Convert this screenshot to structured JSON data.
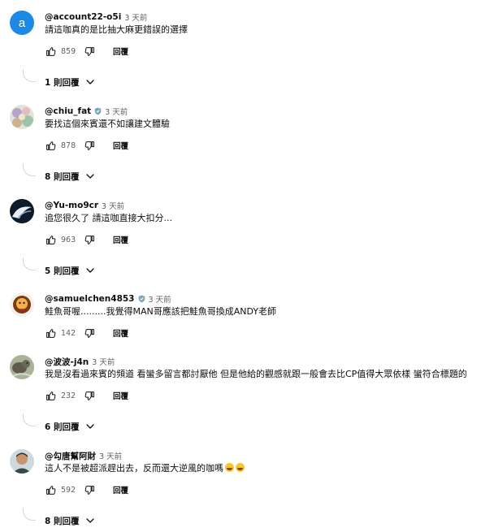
{
  "reply_label": "回覆",
  "comments": [
    {
      "handle": "@account22-o5i",
      "time": "3 天前",
      "text": "請這咖真的是比抽大麻更錯誤的選擇",
      "likes": "859",
      "replies": "1 則回覆",
      "avatar_letter": "a",
      "verified": false,
      "avatar_icon": "letter-avatar"
    },
    {
      "handle": "@chiu_fat",
      "time": "3 天前",
      "text": "要找這個來賓還不如讓建文體驗",
      "likes": "878",
      "replies": "8 則回覆",
      "verified": true,
      "avatar_icon": "floral-avatar"
    },
    {
      "handle": "@Yu-mo9cr",
      "time": "3 天前",
      "text": "追您很久了 請這咖直接大扣分...",
      "likes": "963",
      "replies": "5 則回覆",
      "verified": false,
      "avatar_icon": "dark-avatar"
    },
    {
      "handle": "@samuelchen4853",
      "time": "3 天前",
      "text": "鮭魚哥喔.........我覺得MAN哥應該把鮭魚哥換成ANDY老師",
      "likes": "142",
      "replies": "",
      "verified": true,
      "avatar_icon": "character-avatar"
    },
    {
      "handle": "@波波-j4n",
      "time": "3 天前",
      "text": "我是沒看過來賓的頻道  看蠻多留言都討厭他 但是他給的觀感就跟一般會去比CP值得大眾依樣 蠻符合標題的",
      "likes": "232",
      "replies": "6 則回覆",
      "verified": false,
      "avatar_icon": "photo-avatar"
    },
    {
      "handle": "@勾唐幫阿財",
      "time": "3 天前",
      "text": "這人不是被超派趕出去，反而還大逆風的咖嗎",
      "likes": "592",
      "replies": "8 則回覆",
      "verified": false,
      "avatar_icon": "person-avatar",
      "emoji": "laughing-emoji"
    }
  ],
  "colors": {
    "avatar_blue": "#1e88e5",
    "muted_text": "#606060",
    "thread_line": "#d6d6d6"
  }
}
